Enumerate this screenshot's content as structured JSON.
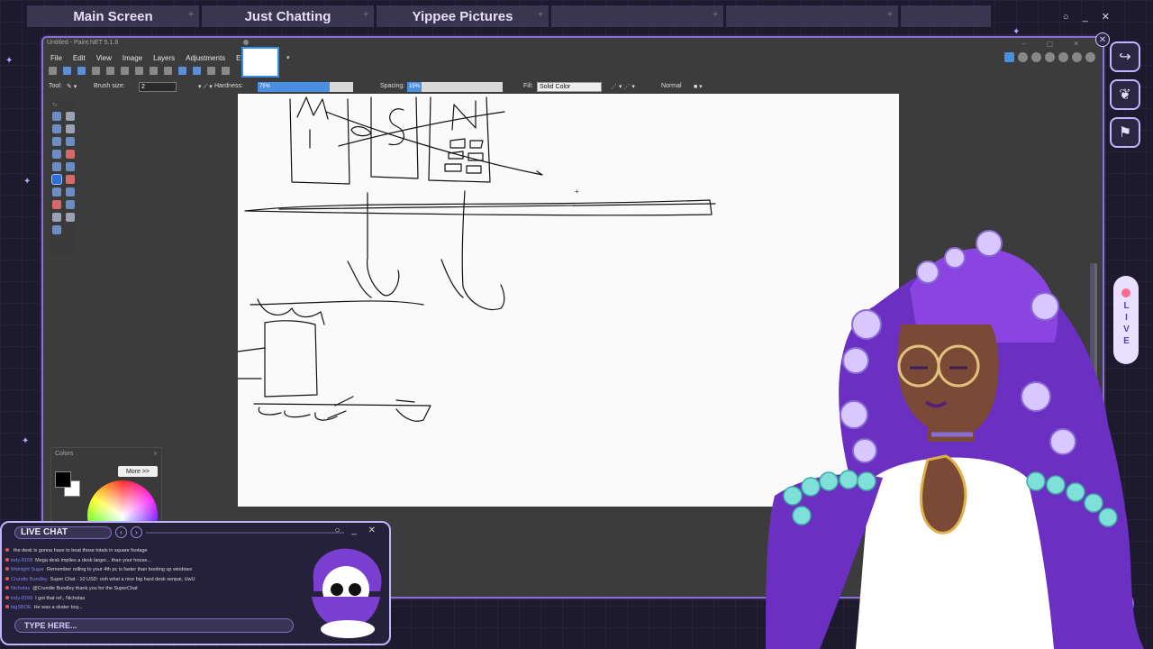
{
  "stream_tabs": [
    {
      "label": "Main Screen"
    },
    {
      "label": "Just Chatting"
    },
    {
      "label": "Yippee Pictures"
    },
    {
      "label": ""
    },
    {
      "label": ""
    },
    {
      "label": ""
    }
  ],
  "paintnet": {
    "window_title": "Untitled - Paint.NET 5.1.8",
    "menu": [
      "File",
      "Edit",
      "View",
      "Image",
      "Layers",
      "Adjustments",
      "Effects"
    ],
    "toolbar": {
      "tool_label": "Tool:",
      "brush_size_label": "Brush size:",
      "brush_size_value": "2",
      "hardness_label": "Hardness:",
      "hardness_value": "75%",
      "hardness_percent": 75,
      "spacing_label": "Spacing:",
      "spacing_value": "15%",
      "spacing_percent": 15,
      "fill_label": "Fill:",
      "fill_value": "Solid Color",
      "blend_mode": "Normal"
    },
    "colors_panel": {
      "title": "Colors",
      "more_button": "More >>",
      "primary_color": "#000000",
      "secondary_color": "#ffffff"
    }
  },
  "live_chat": {
    "title": "LIVE CHAT",
    "input_placeholder": "TYPE HERE...",
    "messages": [
      {
        "user": "",
        "text": "the desk is gonna have to beat those totals in square footage"
      },
      {
        "user": "indy-8168",
        "text": "Mega desk implies a desk larger... than your house..."
      },
      {
        "user": "Midnight Sugar",
        "text": "Remember rolling to your 4th pc is faster than booting up windows"
      },
      {
        "user": "Crundle Bundley",
        "text": "Super Chat - 10 USD: ooh what a nice big hard desk senpai, UwU"
      },
      {
        "user": "Nicholas",
        "text": "@Crundle Bundley thank you for the SuperChat"
      },
      {
        "user": "indy-8168",
        "text": "I got that ref., Nicholas"
      },
      {
        "user": "bigSBOE",
        "text": "He was a skater boy..."
      }
    ]
  },
  "sidebar": {
    "live_label": "LIVE",
    "icons": [
      "share-icon",
      "wing-icon",
      "bookmark-icon"
    ]
  },
  "colors": {
    "accent": "#c4b3ff",
    "background": "#1e1a2e",
    "tab_bg": "#3a3550",
    "selection_blue": "#4a90e2"
  }
}
